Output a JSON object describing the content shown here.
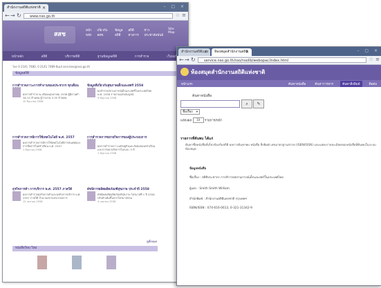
{
  "back_window": {
    "tab_title": "สำนักงานสถิติแห่งชาติ",
    "url": "www.nso.go.th",
    "logo_text": "สสช",
    "top_nav": [
      "หน้าหลัก",
      "เกี่ยวกับ สสช.",
      "ข้อมูลสถิติ",
      "สถิติทางการ",
      "ข่าวประชาสัมพันธ์",
      "Site Map"
    ],
    "sub_nav": [
      "หน้าหลัก",
      "สถิติ",
      "บริการสถิติ",
      "ฐานข้อมูลสถิติ",
      "การสำรวจ",
      "เว็บบอร์ด"
    ],
    "contact_line": "โทร 0 2141 7480, 0 2141 7489 อีเมล์ services@nso.go.th",
    "section_title": "ข้อมูลสถิติ",
    "news": [
      {
        "title": "การสำรวจภาวะการทำงานของประชากร ทุกเดือน 2558",
        "body": "ผลการสำรวจ ณ เดือนพฤษภาคม 2558 ผู้มีงานทำ 38.10 ล้านคน ผู้ว่างงาน 0.35 ล้านคน",
        "date": "10 มิถุนายน 2558"
      },
      {
        "title": "ข้อมูลที่เกี่ยวกับสุขภาพเด็กและสตรี 2558",
        "body": "ผลสำรวจสถานการณ์เด็กและสตรีในประเทศไทย พ.ศ. 2558 รายงานฉบับสมบูรณ์",
        "date": "9 มิถุนายน 2558"
      },
      {
        "title": "การสำรวจการมีการใช้เทคโนโลยี พ.ศ. 2557",
        "body": "ผลการสำรวจการมีการใช้เทคโนโลยีสารสนเทศและการสื่อสารในครัวเรือน พ.ศ. 2557",
        "date": "1 มิถุนายน 2558"
      },
      {
        "title": "การสำรวจการขยายกิจการของผู้ประกอบการ 2558",
        "body": "ผลการสำรวจภาวะเศรษฐกิจและสังคมของครัวเรือน และการขยายกิจการในระยะ 5 ปี",
        "date": "1 มิถุนายน 2558"
      },
      {
        "title": "ธุรกิจการค้า การบริการ พ.ศ. 2557 ภาคใต้",
        "body": "ผลการสำรวจธุรกิจการค้าและธุรกิจการบริการ พ.ศ. 2557 ภาคใต้ จำนวนสถานประกอบการ",
        "date": "12 เมษายน 2558"
      },
      {
        "title": "ดัชนีการผลิตผลิตภัณฑ์สุขภาพ ประจำปี 2558",
        "body": "ดัชนีผลผลิตผลิตภัณฑ์สุขภาพ ไตรมาสที่ 1 ปี 2558 ปรับตัวเพิ่มขึ้นจากไตรมาสก่อน",
        "date": "4 เมษายน 2558"
      }
    ],
    "more_label": "ดูทั้งหมด",
    "books_title": "หนังสือใหม่ ใหม่"
  },
  "front_window": {
    "tabs": [
      {
        "label": "สำนักงานสถิติแห่งชาติ"
      },
      {
        "label": "ห้องสมุดสำนักงานสถิติ"
      }
    ],
    "url": "service.nso.go.th/nso/nsolib/webopac/index.html",
    "site_title": "ห้องสมุดสำนักงานสถิติแห่งชาติ",
    "home_label": "หน้าแรก",
    "nav_items": [
      "ค้นหาหนังสือ",
      "ค้นหาวารสาร",
      "ค้นหาสิ่งพิมพ์",
      "ติดต่อ"
    ],
    "search_title": "ค้นหาหนังสือ",
    "search_field_options": [
      "ชื่อเรื่อง"
    ],
    "selected_field": "ชื่อเรื่อง",
    "per_page_prefix": "แสดงผล",
    "per_page_value": "10",
    "per_page_suffix": "รายการ/หน้า",
    "result_heading": "รายการที่ค้นพบ ได้แก่",
    "result_summary": "ค้นหาชื่อหนังสือที่เกี่ยวข้องกับสถิติ ผลการค้นหาพบ หนังสือ สิ่งพิมพ์ เลขมาตรฐานสากล (ISBN/ISSN) และแสดงรายละเอียดของหนังสือที่ค้นพบในระบบห้องสมุด",
    "details": {
      "label": "ข้อมูลหนังสือ",
      "line1": "ชื่อเรื่อง : สถิติประชากร การสำรวจสถานการณ์เด็กและสตรีในประเทศไทย",
      "line2": "ผู้แต่ง : Smith Smith William",
      "line3": "สำนักพิมพ์ : สำนักงานสถิติแห่งชาติ กรุงเทพฯ",
      "line4": "ISBN/ISSN : 074-616-0613, 0-321-31342-9"
    },
    "search_btn_icon": "search-icon",
    "clear_btn_icon": "clear-icon"
  },
  "colors": {
    "brand_purple": "#6a5ca4",
    "nav_purple": "#7d70b6",
    "section_bar": "#c9c0e4"
  }
}
